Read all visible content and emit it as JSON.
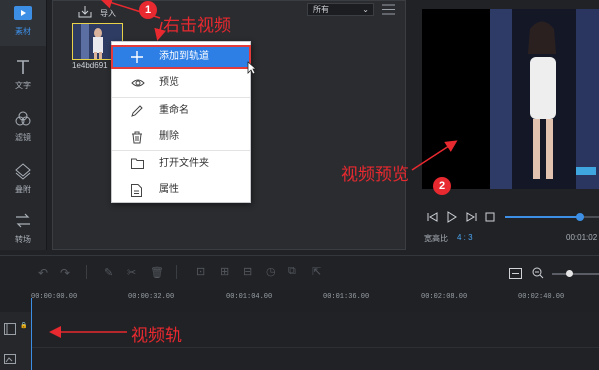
{
  "sidebar": {
    "items": [
      {
        "label": "素材",
        "icon": "media-icon",
        "active": true
      },
      {
        "label": "文字",
        "icon": "text-icon"
      },
      {
        "label": "滤镜",
        "icon": "filter-icon"
      },
      {
        "label": "叠附",
        "icon": "overlay-icon"
      },
      {
        "label": "转场",
        "icon": "transition-icon"
      }
    ]
  },
  "media": {
    "import_label": "导入",
    "filter_value": "所有",
    "thumbnail_name": "1e4bd691"
  },
  "context_menu": {
    "items": [
      {
        "label": "添加到轨道",
        "icon": "plus-icon",
        "highlighted": true
      },
      {
        "label": "预览",
        "icon": "eye-icon"
      },
      {
        "label": "重命名",
        "icon": "pencil-icon"
      },
      {
        "label": "删除",
        "icon": "trash-icon"
      },
      {
        "label": "打开文件夹",
        "icon": "folder-icon"
      },
      {
        "label": "属性",
        "icon": "file-properties-icon"
      }
    ]
  },
  "preview": {
    "ratio_label": "宽高比",
    "ratio_value": "4 : 3",
    "time": "00:01:02"
  },
  "timeline": {
    "ticks": [
      "00:00:00.00",
      "00:00:32.00",
      "00:01:04.00",
      "00:01:36.00",
      "00:02:08.00",
      "00:02:40.00"
    ]
  },
  "annotations": {
    "badge1": "1",
    "badge2": "2",
    "right_click_video": "右击视频",
    "video_preview": "视频预览",
    "video_track": "视频轨"
  },
  "colors": {
    "accent": "#2d7fe6",
    "annotation_red": "#e8292f",
    "panel_bg": "#2a2c30"
  }
}
